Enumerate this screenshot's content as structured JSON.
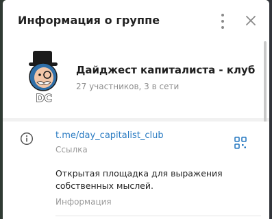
{
  "dialog": {
    "title": "Информация о группе",
    "menu_icon": "more-vertical-icon",
    "close_icon": "close-icon"
  },
  "group": {
    "name": "Дайджест капиталиста - клуб",
    "subtitle": "27 участников, 3 в сети",
    "avatar_text": "DC"
  },
  "info": {
    "link": "t.me/day_capitalist_club",
    "link_label": "Ссылка",
    "description": "Открытая площадка для выражения собственных мыслей.",
    "description_label": "Информация",
    "info_icon": "info-icon",
    "qr_icon": "qr-code-icon"
  },
  "colors": {
    "accent_link": "#2a7bc2",
    "muted_text": "#8d8d8d",
    "panel_bg": "#ffffff",
    "separator_bg": "#f1f1f1"
  }
}
